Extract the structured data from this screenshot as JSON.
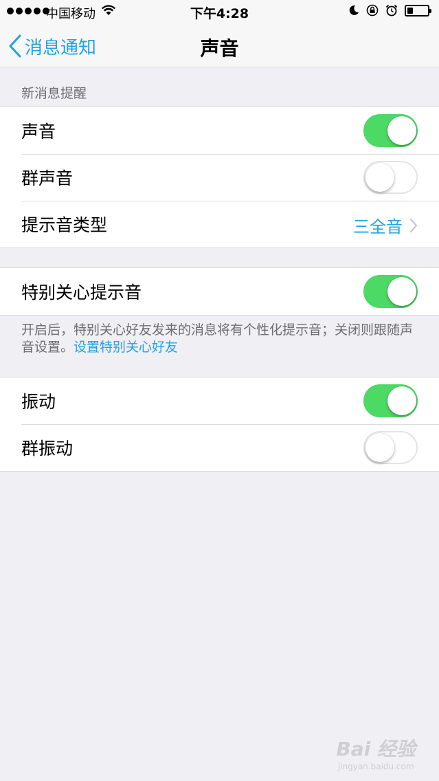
{
  "status_bar": {
    "carrier": "中国移动",
    "time": "下午4:28",
    "battery_level": 0.3
  },
  "nav": {
    "back_label": "消息通知",
    "title": "声音"
  },
  "sections": {
    "new_message": {
      "header": "新消息提醒",
      "rows": [
        {
          "label": "声音",
          "toggle": true
        },
        {
          "label": "群声音",
          "toggle": false
        },
        {
          "label": "提示音类型",
          "value": "三全音"
        }
      ]
    },
    "special_care": {
      "rows": [
        {
          "label": "特别关心提示音",
          "toggle": true
        }
      ],
      "footer_text": "开启后，特别关心好友发来的消息将有个性化提示音；关闭则跟随声音设置。",
      "footer_link": "设置特别关心好友"
    },
    "vibration": {
      "rows": [
        {
          "label": "振动",
          "toggle": true
        },
        {
          "label": "群振动",
          "toggle": false
        }
      ]
    }
  },
  "watermark": {
    "main": "Bai 经验",
    "sub": "jingyan.baidu.com"
  },
  "colors": {
    "accent": "#1fa3e5",
    "toggle_on": "#4cd964",
    "background": "#efeff4"
  }
}
